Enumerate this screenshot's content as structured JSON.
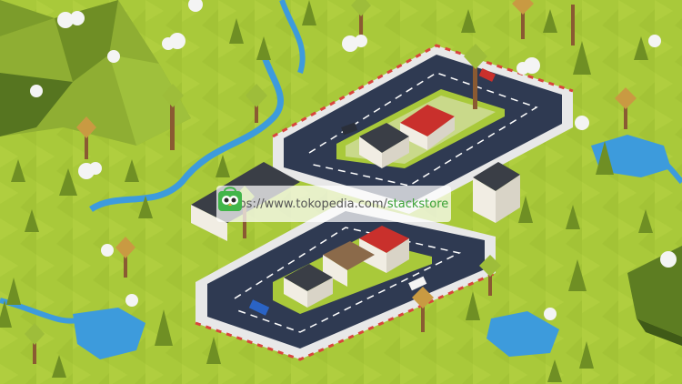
{
  "watermark": {
    "url_prefix": "https://www.tokopedia.com/",
    "store_name": "stackstore",
    "accent_color": "#3aa135",
    "logo_icon": "owl-bag-logo-icon"
  },
  "palette": {
    "grass": "#a9c93a",
    "road": "#2f3a52",
    "curb": "#e8e8e8",
    "curb_stripe": "#d8453c",
    "water": "#3d9bdc",
    "mountain": "#7a9a2c",
    "tree": "#6f8f24",
    "roof_red": "#c9302c",
    "roof_dark": "#3a3e46"
  }
}
